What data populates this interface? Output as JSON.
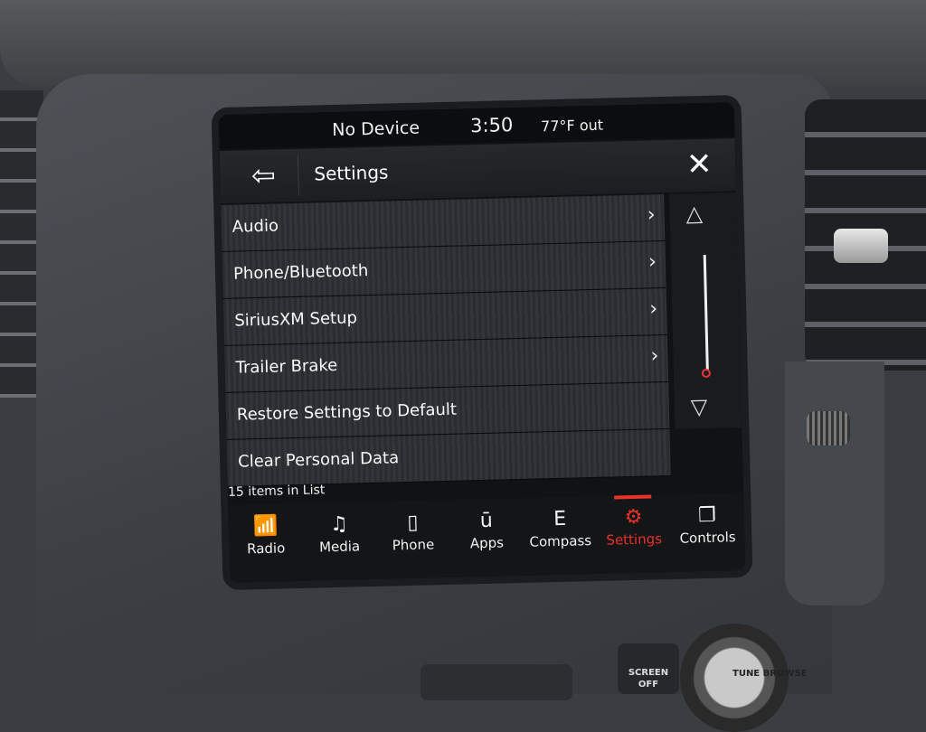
{
  "status": {
    "device": "No Device",
    "time": "3:50",
    "temperature": "77°F out"
  },
  "header": {
    "back_icon": "⇦",
    "title": "Settings",
    "close_icon": "✕"
  },
  "menu": {
    "items": [
      {
        "label": "Audio",
        "chevron": "›"
      },
      {
        "label": "Phone/Bluetooth",
        "chevron": "›"
      },
      {
        "label": "SiriusXM Setup",
        "chevron": "›"
      },
      {
        "label": "Trailer Brake",
        "chevron": "›"
      },
      {
        "label": "Restore Settings to Default",
        "chevron": ""
      },
      {
        "label": "Clear Personal Data",
        "chevron": ""
      }
    ]
  },
  "scroll": {
    "up": "△",
    "down": "▽"
  },
  "list_count": "15 items in List",
  "nav": {
    "items": [
      {
        "label": "Radio",
        "icon": "radio-icon",
        "glyph": "📶"
      },
      {
        "label": "Media",
        "icon": "music-note-icon",
        "glyph": "♫"
      },
      {
        "label": "Phone",
        "icon": "phone-icon",
        "glyph": "▯"
      },
      {
        "label": "Apps",
        "icon": "apps-icon",
        "glyph": "ū"
      },
      {
        "label": "Compass",
        "icon": "compass-icon",
        "glyph": "E"
      },
      {
        "label": "Settings",
        "icon": "gear-icon",
        "glyph": "⚙"
      },
      {
        "label": "Controls",
        "icon": "controls-icon",
        "glyph": "❐"
      }
    ],
    "active_color": "#e8322a"
  },
  "hardware": {
    "screen_off_label": "SCREEN OFF",
    "tune_label": "TUNE BROWSE"
  }
}
